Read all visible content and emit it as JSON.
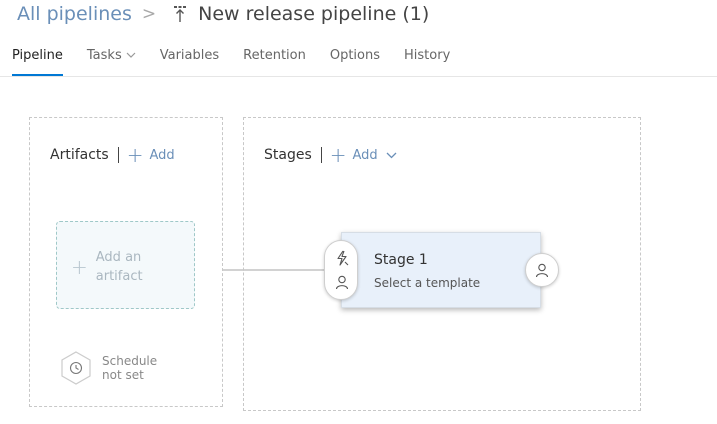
{
  "breadcrumb": {
    "parent": "All pipelines",
    "separator": ">",
    "title": "New release pipeline (1)"
  },
  "tabs": [
    {
      "label": "Pipeline",
      "active": true
    },
    {
      "label": "Tasks",
      "has_dropdown": true
    },
    {
      "label": "Variables"
    },
    {
      "label": "Retention"
    },
    {
      "label": "Options"
    },
    {
      "label": "History"
    }
  ],
  "artifacts": {
    "title": "Artifacts",
    "add_label": "Add",
    "placeholder_line1": "Add an",
    "placeholder_line2": "artifact",
    "schedule_line1": "Schedule",
    "schedule_line2": "not set"
  },
  "stages": {
    "title": "Stages",
    "add_label": "Add",
    "items": [
      {
        "name": "Stage 1",
        "subtitle": "Select a template"
      }
    ]
  },
  "icons": {
    "pipeline": "pipeline-icon",
    "trigger": "lightning-icon",
    "pre_approver": "person-icon",
    "post_approver": "person-icon",
    "schedule": "clock-icon"
  },
  "colors": {
    "accent": "#0078d4",
    "link": "#6a8fb8",
    "stage_bg": "#e8f0fa"
  }
}
